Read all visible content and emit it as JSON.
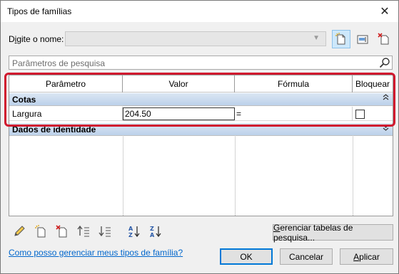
{
  "window": {
    "title": "Tipos de famílias",
    "close_glyph": "✕"
  },
  "name_row": {
    "label_prefix": "D",
    "label_underlined": "i",
    "label_suffix": "gite o nome:",
    "value": ""
  },
  "toolbar_icons": [
    "new-type-icon",
    "rename-type-icon",
    "delete-type-icon"
  ],
  "search": {
    "placeholder": "Parâmetros de pesquisa"
  },
  "grid": {
    "columns": [
      "Parâmetro",
      "Valor",
      "Fórmula",
      "Bloquear"
    ],
    "groups": [
      {
        "label": "Cotas",
        "collapse_glyph": "⌃",
        "rows": [
          {
            "parameter": "Largura",
            "value": "204.50",
            "formula": "=",
            "locked": false
          }
        ]
      },
      {
        "label": "Dados de identidade",
        "collapse_glyph": "⌄",
        "rows": []
      }
    ]
  },
  "bottom_icons": [
    "edit-pencil-icon",
    "new-parameter-icon",
    "delete-parameter-icon",
    "move-up-icon",
    "move-down-icon",
    "sort-ascending-icon",
    "sort-descending-icon"
  ],
  "buttons": {
    "lookup_prefix": "G",
    "lookup_rest": "erenciar tabelas de pesquisa...",
    "ok": "OK",
    "cancel": "Cancelar",
    "apply_prefix": "A",
    "apply_rest": "plicar"
  },
  "help_link": "Como posso gerenciar meus tipos de família?",
  "colors": {
    "highlight": "#d0192f",
    "group_header": "#c8d8ee",
    "link": "#0066cc"
  }
}
